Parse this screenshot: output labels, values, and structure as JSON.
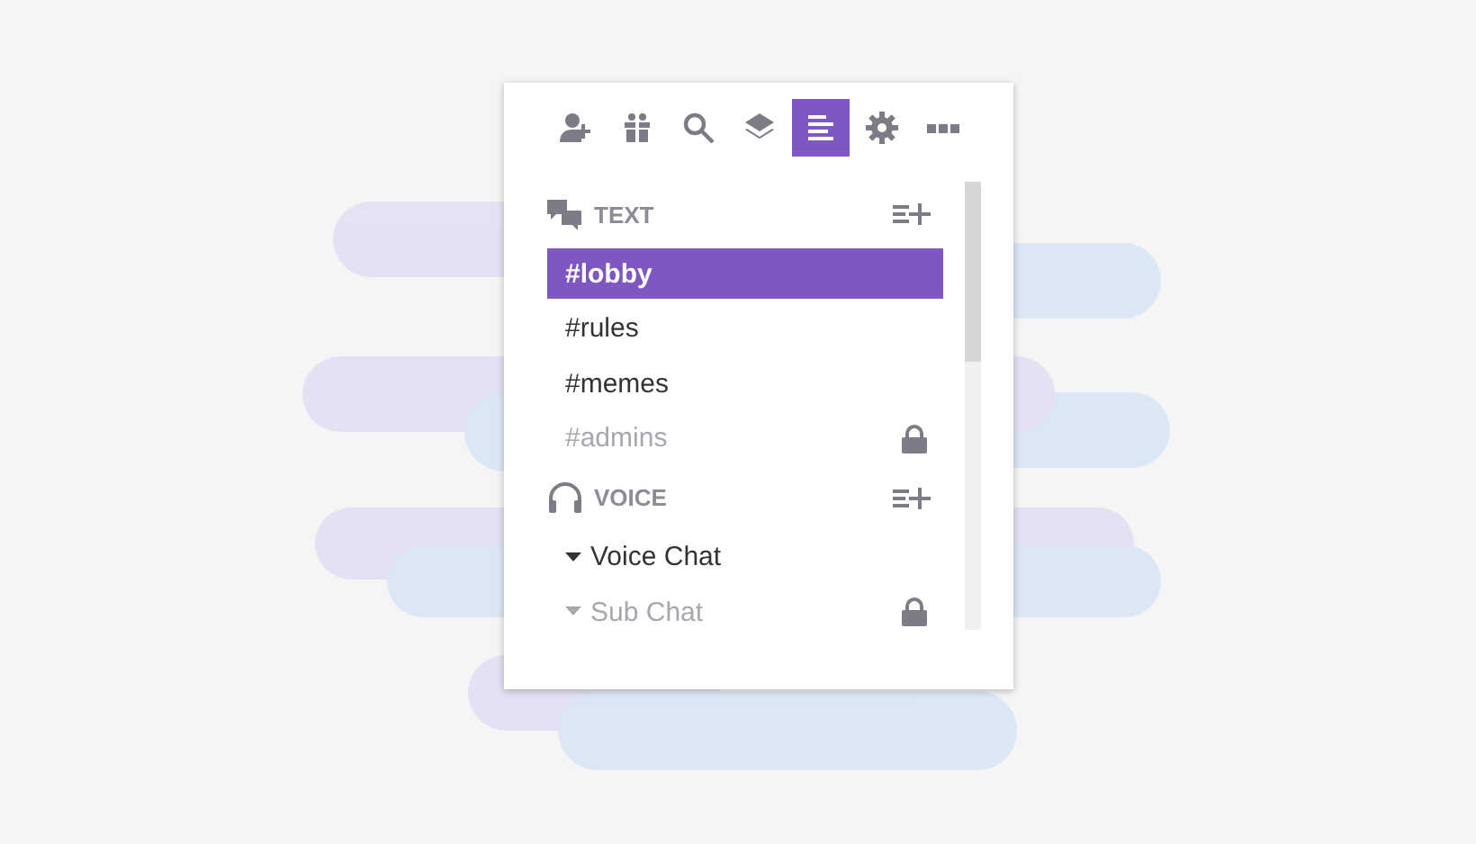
{
  "toolbar": [
    {
      "kind": "add-user",
      "selected": false
    },
    {
      "kind": "gift",
      "selected": false
    },
    {
      "kind": "search",
      "selected": false
    },
    {
      "kind": "layers",
      "selected": false
    },
    {
      "kind": "list",
      "selected": true
    },
    {
      "kind": "gear",
      "selected": false
    },
    {
      "kind": "more",
      "selected": false
    }
  ],
  "sections": [
    {
      "kind": "text",
      "title": "TEXT",
      "channels": [
        {
          "name": "#lobby",
          "selected": true,
          "locked": false
        },
        {
          "name": "#rules",
          "selected": false,
          "locked": false
        },
        {
          "name": "#memes",
          "selected": false,
          "locked": false
        },
        {
          "name": "#admins",
          "selected": false,
          "locked": true
        }
      ]
    },
    {
      "kind": "voice",
      "title": "VOICE",
      "channels": [
        {
          "name": "Voice Chat",
          "selected": false,
          "locked": false
        },
        {
          "name": "Sub Chat",
          "selected": false,
          "locked": true
        }
      ]
    }
  ]
}
